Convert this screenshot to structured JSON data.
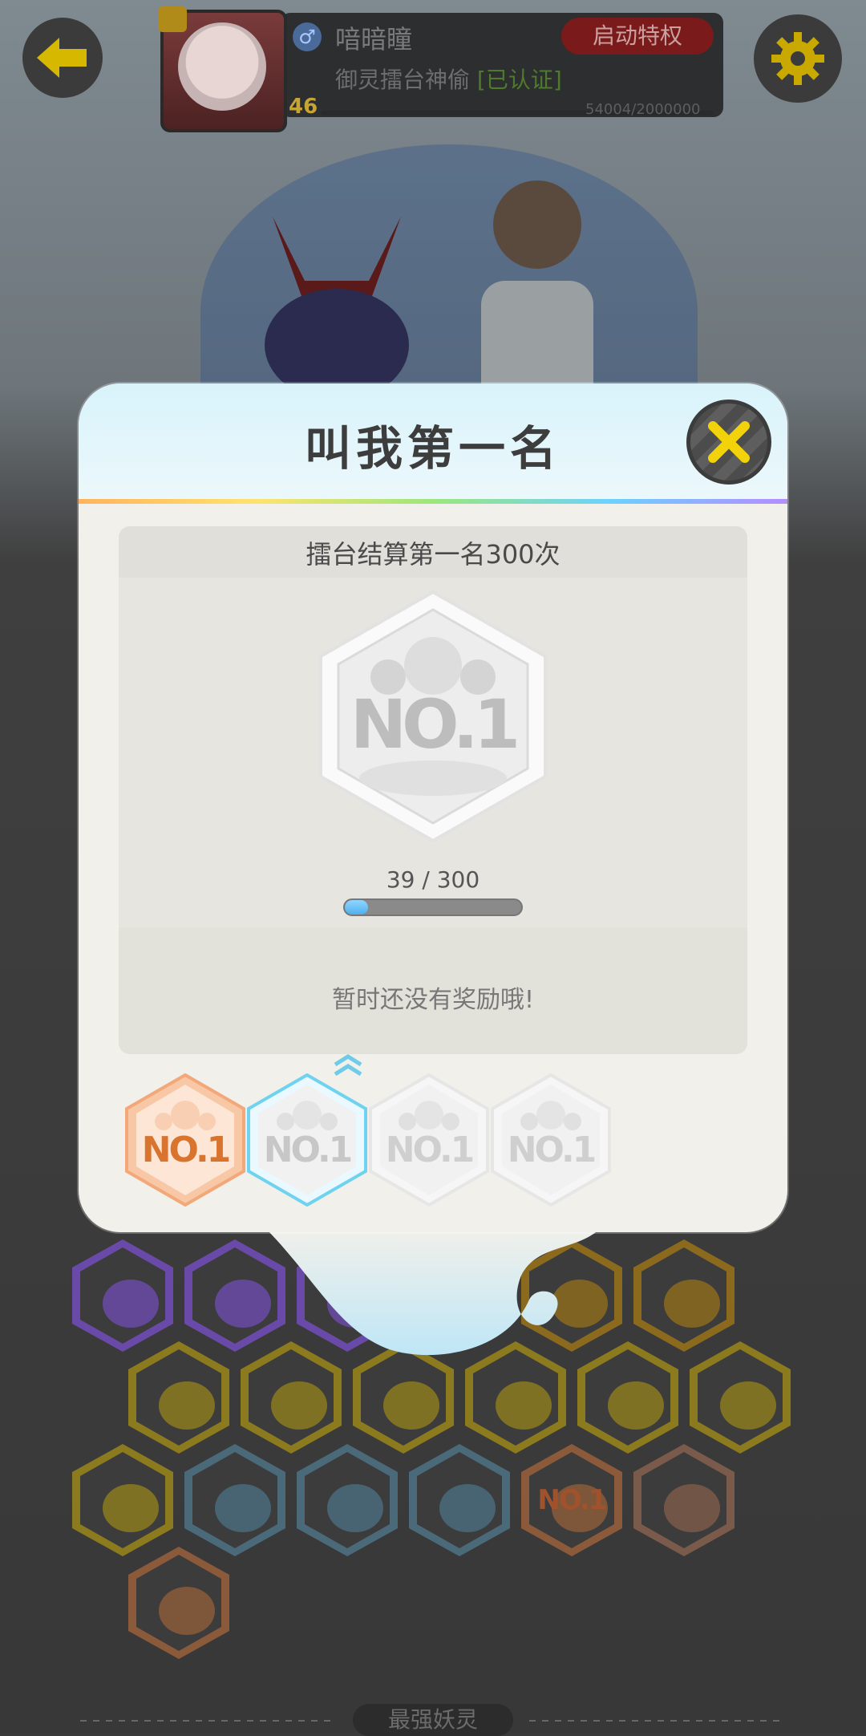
{
  "top_bar": {
    "player_name": "喑暗瞳",
    "gender_symbol": "♂",
    "level": "46",
    "privilege_button": "启动特权",
    "title": "御灵擂台神偷",
    "verified_tag": "[已认证]",
    "exp_text": "54004/2000000"
  },
  "modal": {
    "title": "叫我第一名",
    "task_title": "擂台结算第一名300次",
    "badge_text": "NO.1",
    "progress_text": "39 / 300",
    "progress_fraction": 0.13,
    "reward_text": "暂时还没有奖励哦!",
    "tiers": [
      {
        "label": "NO.1",
        "state": "earned",
        "color": "#e07a3a"
      },
      {
        "label": "NO.1",
        "state": "selected",
        "color": "#7fd6f0"
      },
      {
        "label": "NO.1",
        "state": "locked",
        "color": "#cfcfcf"
      },
      {
        "label": "NO.1",
        "state": "locked",
        "color": "#e0e0e0"
      }
    ]
  },
  "grid_badge_text": "NO.1",
  "bottom_tab": "最强妖灵",
  "colors": {
    "accent_yellow": "#f2d20a",
    "progress_blue": "#4fb0ee"
  }
}
